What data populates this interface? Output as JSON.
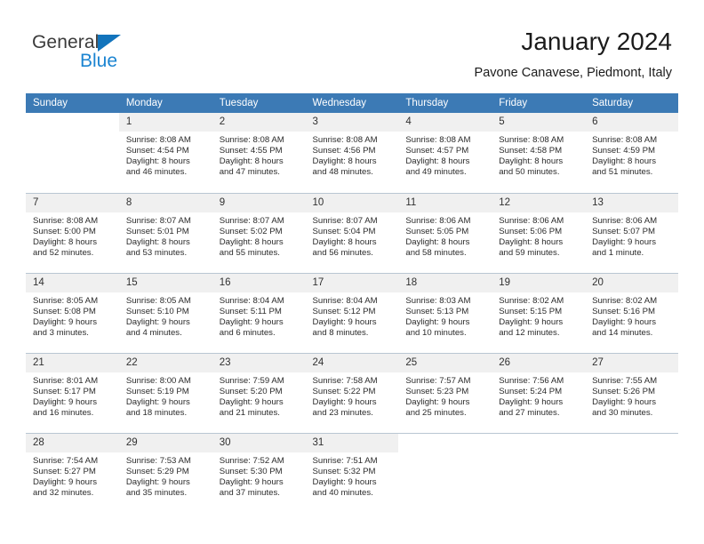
{
  "brand": {
    "name_top": "General",
    "name_bottom": "Blue",
    "flag_icon": "triangle-flag-icon"
  },
  "header": {
    "month_title": "January 2024",
    "location": "Pavone Canavese, Piedmont, Italy"
  },
  "colors": {
    "header_blue": "#3c7ab5",
    "brand_blue": "#1b84d1",
    "daynum_band": "#f0f0f0",
    "grid_line": "#cfcfcf"
  },
  "weekdays": [
    "Sunday",
    "Monday",
    "Tuesday",
    "Wednesday",
    "Thursday",
    "Friday",
    "Saturday"
  ],
  "weeks": [
    [
      {
        "day": "",
        "empty": true
      },
      {
        "day": "1",
        "sunrise": "Sunrise: 8:08 AM",
        "sunset": "Sunset: 4:54 PM",
        "daylight1": "Daylight: 8 hours",
        "daylight2": "and 46 minutes."
      },
      {
        "day": "2",
        "sunrise": "Sunrise: 8:08 AM",
        "sunset": "Sunset: 4:55 PM",
        "daylight1": "Daylight: 8 hours",
        "daylight2": "and 47 minutes."
      },
      {
        "day": "3",
        "sunrise": "Sunrise: 8:08 AM",
        "sunset": "Sunset: 4:56 PM",
        "daylight1": "Daylight: 8 hours",
        "daylight2": "and 48 minutes."
      },
      {
        "day": "4",
        "sunrise": "Sunrise: 8:08 AM",
        "sunset": "Sunset: 4:57 PM",
        "daylight1": "Daylight: 8 hours",
        "daylight2": "and 49 minutes."
      },
      {
        "day": "5",
        "sunrise": "Sunrise: 8:08 AM",
        "sunset": "Sunset: 4:58 PM",
        "daylight1": "Daylight: 8 hours",
        "daylight2": "and 50 minutes."
      },
      {
        "day": "6",
        "sunrise": "Sunrise: 8:08 AM",
        "sunset": "Sunset: 4:59 PM",
        "daylight1": "Daylight: 8 hours",
        "daylight2": "and 51 minutes."
      }
    ],
    [
      {
        "day": "7",
        "sunrise": "Sunrise: 8:08 AM",
        "sunset": "Sunset: 5:00 PM",
        "daylight1": "Daylight: 8 hours",
        "daylight2": "and 52 minutes."
      },
      {
        "day": "8",
        "sunrise": "Sunrise: 8:07 AM",
        "sunset": "Sunset: 5:01 PM",
        "daylight1": "Daylight: 8 hours",
        "daylight2": "and 53 minutes."
      },
      {
        "day": "9",
        "sunrise": "Sunrise: 8:07 AM",
        "sunset": "Sunset: 5:02 PM",
        "daylight1": "Daylight: 8 hours",
        "daylight2": "and 55 minutes."
      },
      {
        "day": "10",
        "sunrise": "Sunrise: 8:07 AM",
        "sunset": "Sunset: 5:04 PM",
        "daylight1": "Daylight: 8 hours",
        "daylight2": "and 56 minutes."
      },
      {
        "day": "11",
        "sunrise": "Sunrise: 8:06 AM",
        "sunset": "Sunset: 5:05 PM",
        "daylight1": "Daylight: 8 hours",
        "daylight2": "and 58 minutes."
      },
      {
        "day": "12",
        "sunrise": "Sunrise: 8:06 AM",
        "sunset": "Sunset: 5:06 PM",
        "daylight1": "Daylight: 8 hours",
        "daylight2": "and 59 minutes."
      },
      {
        "day": "13",
        "sunrise": "Sunrise: 8:06 AM",
        "sunset": "Sunset: 5:07 PM",
        "daylight1": "Daylight: 9 hours",
        "daylight2": "and 1 minute."
      }
    ],
    [
      {
        "day": "14",
        "sunrise": "Sunrise: 8:05 AM",
        "sunset": "Sunset: 5:08 PM",
        "daylight1": "Daylight: 9 hours",
        "daylight2": "and 3 minutes."
      },
      {
        "day": "15",
        "sunrise": "Sunrise: 8:05 AM",
        "sunset": "Sunset: 5:10 PM",
        "daylight1": "Daylight: 9 hours",
        "daylight2": "and 4 minutes."
      },
      {
        "day": "16",
        "sunrise": "Sunrise: 8:04 AM",
        "sunset": "Sunset: 5:11 PM",
        "daylight1": "Daylight: 9 hours",
        "daylight2": "and 6 minutes."
      },
      {
        "day": "17",
        "sunrise": "Sunrise: 8:04 AM",
        "sunset": "Sunset: 5:12 PM",
        "daylight1": "Daylight: 9 hours",
        "daylight2": "and 8 minutes."
      },
      {
        "day": "18",
        "sunrise": "Sunrise: 8:03 AM",
        "sunset": "Sunset: 5:13 PM",
        "daylight1": "Daylight: 9 hours",
        "daylight2": "and 10 minutes."
      },
      {
        "day": "19",
        "sunrise": "Sunrise: 8:02 AM",
        "sunset": "Sunset: 5:15 PM",
        "daylight1": "Daylight: 9 hours",
        "daylight2": "and 12 minutes."
      },
      {
        "day": "20",
        "sunrise": "Sunrise: 8:02 AM",
        "sunset": "Sunset: 5:16 PM",
        "daylight1": "Daylight: 9 hours",
        "daylight2": "and 14 minutes."
      }
    ],
    [
      {
        "day": "21",
        "sunrise": "Sunrise: 8:01 AM",
        "sunset": "Sunset: 5:17 PM",
        "daylight1": "Daylight: 9 hours",
        "daylight2": "and 16 minutes."
      },
      {
        "day": "22",
        "sunrise": "Sunrise: 8:00 AM",
        "sunset": "Sunset: 5:19 PM",
        "daylight1": "Daylight: 9 hours",
        "daylight2": "and 18 minutes."
      },
      {
        "day": "23",
        "sunrise": "Sunrise: 7:59 AM",
        "sunset": "Sunset: 5:20 PM",
        "daylight1": "Daylight: 9 hours",
        "daylight2": "and 21 minutes."
      },
      {
        "day": "24",
        "sunrise": "Sunrise: 7:58 AM",
        "sunset": "Sunset: 5:22 PM",
        "daylight1": "Daylight: 9 hours",
        "daylight2": "and 23 minutes."
      },
      {
        "day": "25",
        "sunrise": "Sunrise: 7:57 AM",
        "sunset": "Sunset: 5:23 PM",
        "daylight1": "Daylight: 9 hours",
        "daylight2": "and 25 minutes."
      },
      {
        "day": "26",
        "sunrise": "Sunrise: 7:56 AM",
        "sunset": "Sunset: 5:24 PM",
        "daylight1": "Daylight: 9 hours",
        "daylight2": "and 27 minutes."
      },
      {
        "day": "27",
        "sunrise": "Sunrise: 7:55 AM",
        "sunset": "Sunset: 5:26 PM",
        "daylight1": "Daylight: 9 hours",
        "daylight2": "and 30 minutes."
      }
    ],
    [
      {
        "day": "28",
        "sunrise": "Sunrise: 7:54 AM",
        "sunset": "Sunset: 5:27 PM",
        "daylight1": "Daylight: 9 hours",
        "daylight2": "and 32 minutes."
      },
      {
        "day": "29",
        "sunrise": "Sunrise: 7:53 AM",
        "sunset": "Sunset: 5:29 PM",
        "daylight1": "Daylight: 9 hours",
        "daylight2": "and 35 minutes."
      },
      {
        "day": "30",
        "sunrise": "Sunrise: 7:52 AM",
        "sunset": "Sunset: 5:30 PM",
        "daylight1": "Daylight: 9 hours",
        "daylight2": "and 37 minutes."
      },
      {
        "day": "31",
        "sunrise": "Sunrise: 7:51 AM",
        "sunset": "Sunset: 5:32 PM",
        "daylight1": "Daylight: 9 hours",
        "daylight2": "and 40 minutes."
      },
      {
        "day": "",
        "empty": true
      },
      {
        "day": "",
        "empty": true
      },
      {
        "day": "",
        "empty": true
      }
    ]
  ]
}
